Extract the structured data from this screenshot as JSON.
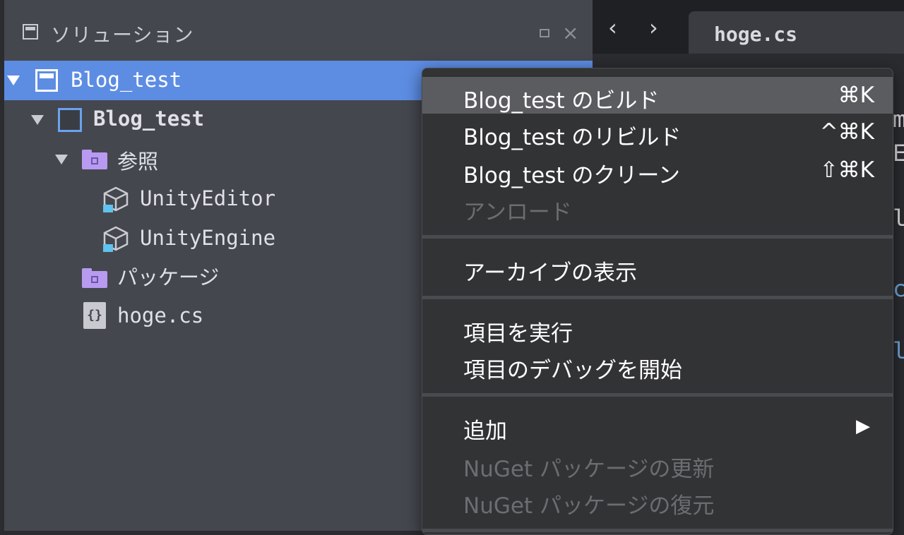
{
  "pad": {
    "title": "ソリューション",
    "items": [
      {
        "label": "Blog_test",
        "kind": "solution"
      },
      {
        "label": "Blog_test",
        "kind": "project"
      },
      {
        "label": "参照",
        "kind": "folder"
      },
      {
        "label": "UnityEditor",
        "kind": "reference"
      },
      {
        "label": "UnityEngine",
        "kind": "reference"
      },
      {
        "label": "パッケージ",
        "kind": "folder"
      },
      {
        "label": "hoge.cs",
        "kind": "csharp-file",
        "icon_text": "{}"
      }
    ]
  },
  "tabs": {
    "back": "‹",
    "forward": "›",
    "active_tab": "hoge.cs"
  },
  "editor": {
    "fragments": [
      "m",
      "E",
      "l",
      "c",
      "l"
    ]
  },
  "menu": {
    "items": [
      {
        "label": "Blog_test のビルド",
        "shortcut": "⌘K",
        "highlighted": true
      },
      {
        "label": "Blog_test のリビルド",
        "shortcut": "^⌘K"
      },
      {
        "label": "Blog_test のクリーン",
        "shortcut": "⇧⌘K"
      },
      {
        "label": "アンロード",
        "disabled": true
      },
      {
        "label": "アーカイブの表示"
      },
      {
        "label": "項目を実行"
      },
      {
        "label": "項目のデバッグを開始"
      },
      {
        "label": "追加",
        "submenu_arrow": "▶"
      },
      {
        "label": "NuGet パッケージの更新",
        "disabled": true
      },
      {
        "label": "NuGet パッケージの復元",
        "disabled": true
      }
    ]
  },
  "colors": {
    "selection": "#5d8de3",
    "pad_bg": "#45474f",
    "menu_bg": "#323335",
    "menu_highlight": "#5b5c60",
    "folder": "#b89af0",
    "project": "#6aa3ee"
  }
}
